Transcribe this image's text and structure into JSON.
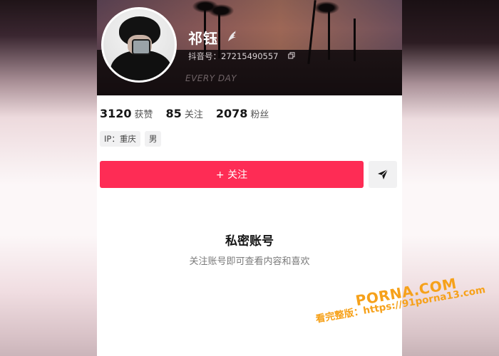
{
  "profile": {
    "name": "祁钰",
    "douyin_id": "抖音号：27215490557",
    "banner_text": "EVERY DAY",
    "icons": {
      "badge": "wing-icon",
      "copy": "copy-icon",
      "share": "share-arrow-icon"
    }
  },
  "stats": [
    {
      "value": "3120",
      "label": "获赞"
    },
    {
      "value": "85",
      "label": "关注"
    },
    {
      "value": "2078",
      "label": "粉丝"
    }
  ],
  "tags": [
    "IP：重庆",
    "男"
  ],
  "actions": {
    "follow_label": "+ 关注"
  },
  "private": {
    "title": "私密账号",
    "subtitle": "关注账号即可查看内容和喜欢"
  },
  "watermark": {
    "logo": "PORNA.COM",
    "url": "看完整版：https://91porna13.com"
  },
  "colors": {
    "accent": "#fe2c55",
    "watermark": "#f6a11a"
  }
}
